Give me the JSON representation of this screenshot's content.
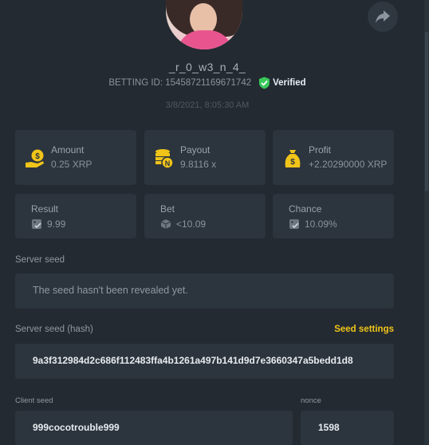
{
  "profile": {
    "username": "_r_0_w3_n_4_",
    "betting_id_label": "BETTING ID: 15458721169671742",
    "verified_label": "Verified",
    "date": "3/8/2021, 8:05:30 AM"
  },
  "stats": {
    "amount": {
      "label": "Amount",
      "value": "0.25 XRP"
    },
    "payout": {
      "label": "Payout",
      "value": "9.8116 x"
    },
    "profit": {
      "label": "Profit",
      "value": "+2.20290000 XRP"
    }
  },
  "details": {
    "result": {
      "label": "Result",
      "value": "9.99"
    },
    "bet": {
      "label": "Bet",
      "value": "<10.09"
    },
    "chance": {
      "label": "Chance",
      "value": "10.09%"
    }
  },
  "server_seed": {
    "label": "Server seed",
    "value": "The seed hasn't been revealed yet."
  },
  "server_seed_hash": {
    "label": "Server seed (hash)",
    "settings_label": "Seed settings",
    "value": "9a3f312984d2c686f112483ffa4b1261a497b141d9d7e3660347a5bedd1d8"
  },
  "client_seed": {
    "label": "Client seed",
    "value": "999cocotrouble999"
  },
  "nonce": {
    "label": "nonce",
    "value": "1598"
  },
  "colors": {
    "accent": "#f0c419",
    "verified": "#3ac95a",
    "background": "#232a31",
    "card": "#2c343d"
  },
  "icons": [
    "share-icon",
    "verified-check-icon",
    "coin-hand-icon",
    "coin-stack-icon",
    "money-bag-icon",
    "dice-check-icon",
    "dice-icon"
  ]
}
